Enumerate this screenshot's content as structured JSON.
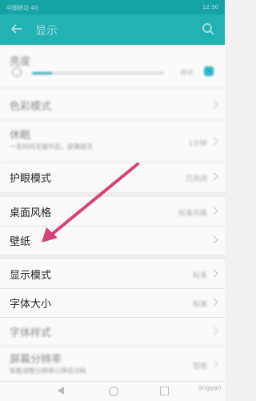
{
  "status_bar": {
    "left": "中国移动 4G",
    "right": "12:30"
  },
  "app_bar": {
    "title": "显示"
  },
  "settings": {
    "brightness": {
      "label": "亮度",
      "auto_label": "自动",
      "level_percent": 15
    },
    "items": [
      {
        "label": "色彩模式",
        "value": ""
      },
      {
        "label": "休眠",
        "sublabel": "一定时间无操作后，屏幕熄灭",
        "value": "1分钟"
      },
      {
        "label": "护眼模式",
        "value": "已关闭"
      },
      {
        "label": "桌面风格",
        "value": "标准风格"
      },
      {
        "label": "壁纸",
        "value": ""
      },
      {
        "label": "显示模式",
        "value": "标准"
      },
      {
        "label": "字体大小",
        "value": "标准"
      },
      {
        "label": "字体样式",
        "value": ""
      },
      {
        "label": "屏幕分辨率",
        "sublabel": "智能调整分辨率以降低功耗",
        "value": "智能"
      }
    ]
  },
  "nav": {
    "watermark": "jingyan"
  },
  "colors": {
    "accent": "#23b2b2",
    "arrow": "#d8407a"
  }
}
